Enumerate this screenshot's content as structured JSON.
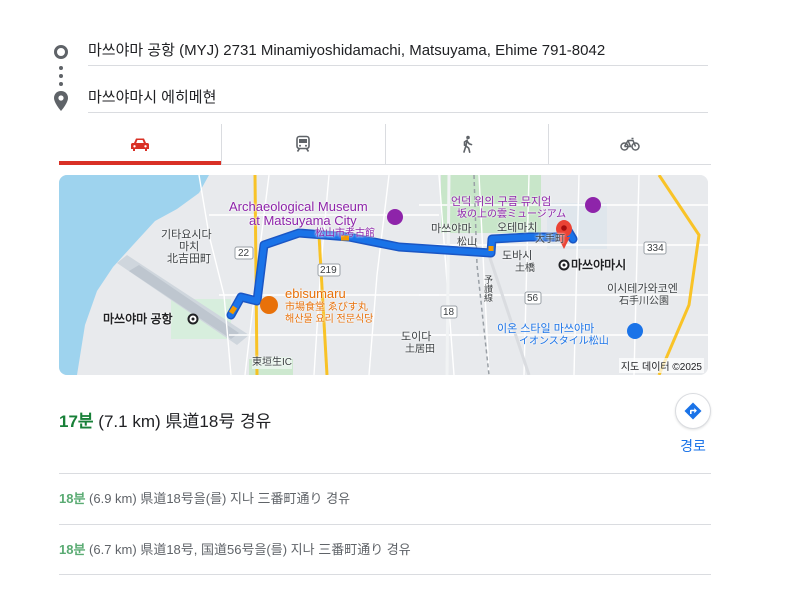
{
  "origin": {
    "value": "마쓰야마 공항 (MYJ) 2731 Minamiyoshidamachi, Matsuyama, Ehime 791-8042"
  },
  "destination": {
    "value": "마쓰야마시 에히메현"
  },
  "modes": [
    {
      "icon": "car-icon",
      "active": true
    },
    {
      "icon": "train-icon",
      "active": false
    },
    {
      "icon": "walk-icon",
      "active": false
    },
    {
      "icon": "bicycle-icon",
      "active": false
    }
  ],
  "colors": {
    "active_mode": "#d93025",
    "route": "#1a73e8",
    "duration": "#188038",
    "link": "#1a73e8"
  },
  "map": {
    "labels": {
      "museum": "Archaeological Museum",
      "museum2": "at Matsuyama City",
      "museum_jp": "松山市考古館",
      "kita1": "기타요시다",
      "kita2": "마치",
      "kita_jp": "北吉田町",
      "airport": "마쓰야마 공항",
      "ebisumaru": "ebisumaru",
      "ebisumaru_jp": "市場食堂 ゑびす丸",
      "ebisumaru_kr": "해산물 요리 전문식당",
      "higashi_ic": "東垣生IC",
      "cloud_museum": "언덕 위의 구름 뮤지엄",
      "cloud_jp": "坂の上の雲ミュージアム",
      "matsuyama_st": "마쓰야마",
      "matsuyama_jp": "松山",
      "otemachi": "오테마치",
      "otemachi_jp": "大手町",
      "dobashi": "도바시",
      "dobashi_jp": "土橋",
      "yosan": "予讃線",
      "city": "마쓰야마시",
      "ishite": "이시테가와코엔",
      "ishite_jp": "石手川公園",
      "doida": "도이다",
      "doida_jp": "土居田",
      "aeon": "이온 스타일 마쓰야마",
      "aeon_jp": "イオンスタイル松山",
      "r22": "22",
      "r219": "219",
      "r18": "18",
      "r56": "56",
      "r334": "334"
    },
    "attribution": "지도 데이터 ©2025"
  },
  "summary": {
    "duration": "17분",
    "detail": "(7.1 km) 県道18号 경유"
  },
  "route_button": {
    "label": "경로",
    "icon": "directions-icon"
  },
  "alternatives": [
    {
      "duration": "18분",
      "detail": "(6.9 km) 県道18号을(를) 지나 三番町通り 경유"
    },
    {
      "duration": "18분",
      "detail": "(6.7 km) 県道18号, 国道56号을(를) 지나 三番町通り 경유"
    }
  ]
}
